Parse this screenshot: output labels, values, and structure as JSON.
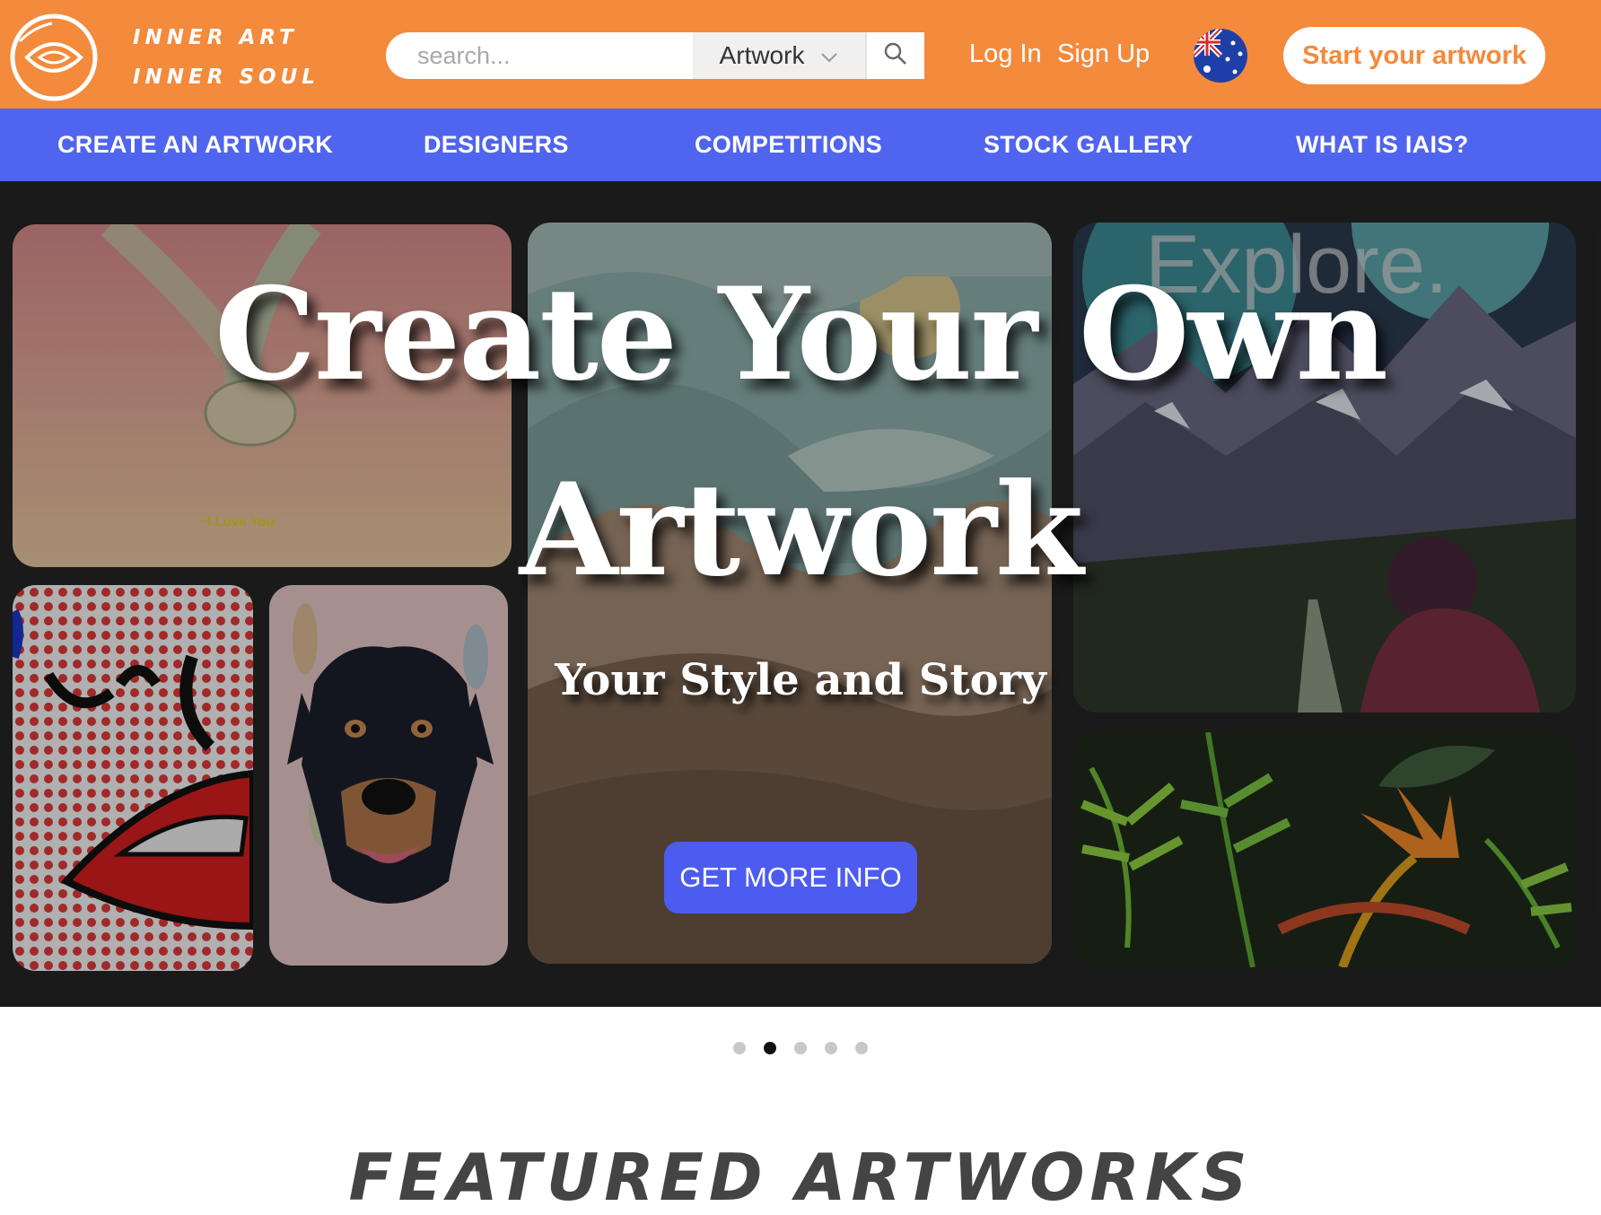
{
  "header": {
    "logo_line1": "INNER ART",
    "logo_line2": "INNER SOUL",
    "search_placeholder": "search...",
    "search_category": "Artwork",
    "login_label": "Log In",
    "signup_label": "Sign Up",
    "region_flag": "australia-flag-icon",
    "start_label": "Start your artwork"
  },
  "nav": {
    "items": [
      "CREATE AN ARTWORK",
      "DESIGNERS",
      "COMPETITIONS",
      "STOCK GALLERY",
      "WHAT IS IAIS?"
    ]
  },
  "hero": {
    "title_line1": "Create Your Own",
    "title_line2": "Artwork",
    "subtitle": "Your Style and Story",
    "cta_label": "GET MORE INFO",
    "tile_caption_love": "~I Love You",
    "tile_caption_explore": "Explore.",
    "slide_count": 5,
    "active_slide": 2
  },
  "section": {
    "featured_title": "FEATURED ARTWORKS"
  },
  "colors": {
    "header_bg": "#f48a3b",
    "nav_bg": "#5065ef",
    "hero_bg": "#252525",
    "cta_bg": "#4c5cf0"
  }
}
